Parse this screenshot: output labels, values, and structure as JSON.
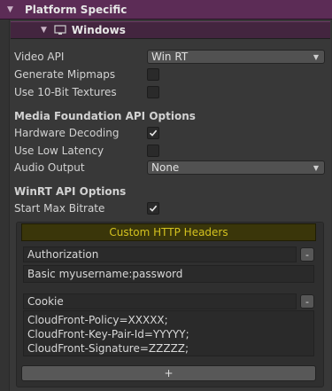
{
  "section_header": {
    "label": "Platform Specific"
  },
  "windows_header": {
    "label": "Windows"
  },
  "video_api": {
    "label": "Video API",
    "value": "Win RT"
  },
  "generate_mipmaps": {
    "label": "Generate Mipmaps",
    "checked": false
  },
  "use_10bit": {
    "label": "Use 10-Bit Textures",
    "checked": false
  },
  "media_foundation": {
    "heading": "Media Foundation API Options"
  },
  "hardware_decoding": {
    "label": "Hardware Decoding",
    "checked": true
  },
  "low_latency": {
    "label": "Use Low Latency",
    "checked": false
  },
  "audio_output": {
    "label": "Audio Output",
    "value": "None"
  },
  "winrt": {
    "heading": "WinRT API Options"
  },
  "start_max_bitrate": {
    "label": "Start Max Bitrate",
    "checked": true
  },
  "custom_headers": {
    "title": "Custom HTTP Headers",
    "items": [
      {
        "name": "Authorization",
        "value": "Basic myusername:password"
      },
      {
        "name": "Cookie",
        "value_lines": [
          "CloudFront-Policy=XXXXX;",
          "CloudFront-Key-Pair-Id=YYYYY;",
          "CloudFront-Signature=ZZZZZ;"
        ]
      }
    ],
    "remove_label": "-",
    "add_label": "+"
  },
  "colors": {
    "purple_header": "#5c2c56",
    "gold_text": "#d4c21f"
  }
}
